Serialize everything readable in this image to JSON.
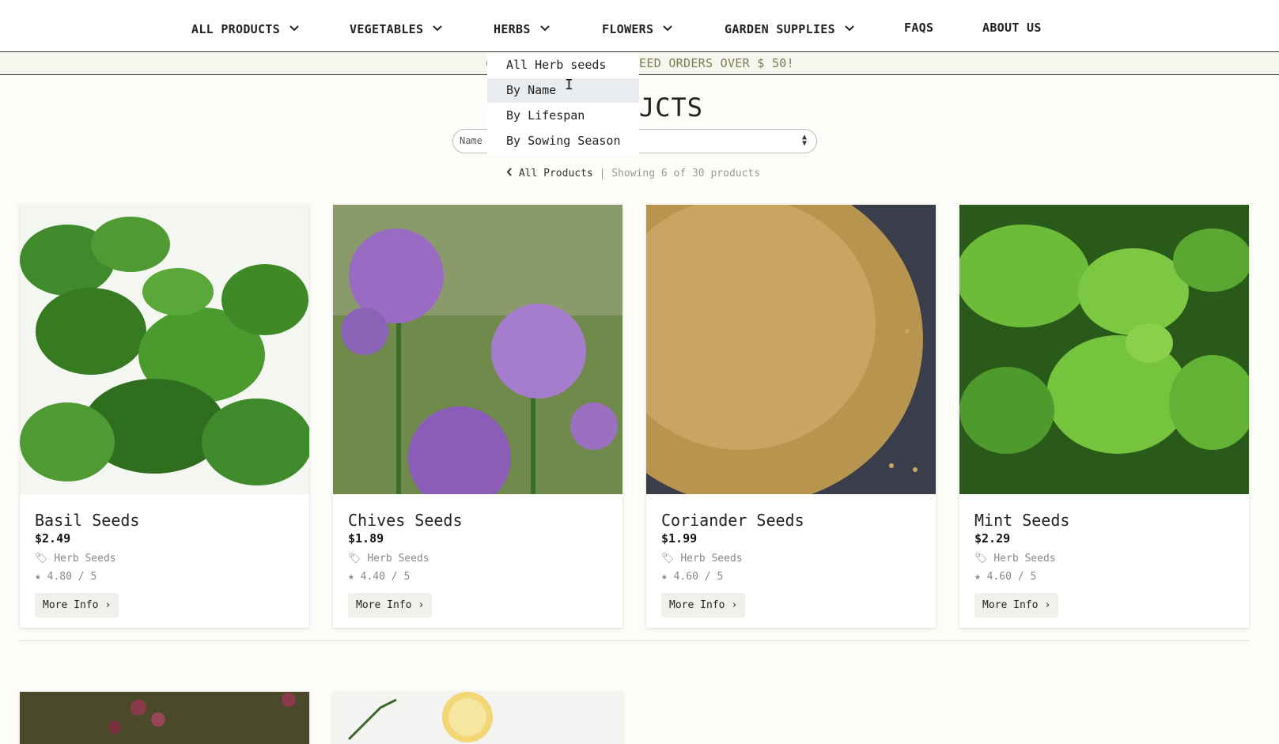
{
  "nav": {
    "items": [
      {
        "label": "ALL PRODUCTS",
        "has_menu": true
      },
      {
        "label": "VEGETABLES",
        "has_menu": true
      },
      {
        "label": "HERBS",
        "has_menu": true
      },
      {
        "label": "FLOWERS",
        "has_menu": true
      },
      {
        "label": "GARDEN SUPPLIES",
        "has_menu": true
      },
      {
        "label": "FAQS",
        "has_menu": false
      },
      {
        "label": "ABOUT US",
        "has_menu": false
      }
    ]
  },
  "banner": {
    "visible_start": "(",
    "visible_end": "EED ORDERS OVER $ 50!"
  },
  "dropdown": {
    "items": [
      {
        "label": "All Herb seeds"
      },
      {
        "label": "By Name"
      },
      {
        "label": "By Lifespan"
      },
      {
        "label": "By Sowing Season"
      }
    ],
    "active": "By Name"
  },
  "page": {
    "title_visible": "JCTS",
    "sort_label": "Name",
    "back_link": "All Products",
    "separator": "|",
    "showing": "Showing 6 of 30 products"
  },
  "products": [
    {
      "name": "Basil Seeds",
      "price": "$2.49",
      "category": "Herb Seeds",
      "rating": "4.80",
      "rating_max": "/ 5",
      "button": "More Info"
    },
    {
      "name": "Chives Seeds",
      "price": "$1.89",
      "category": "Herb Seeds",
      "rating": "4.40",
      "rating_max": "/ 5",
      "button": "More Info"
    },
    {
      "name": "Coriander Seeds",
      "price": "$1.99",
      "category": "Herb Seeds",
      "rating": "4.60",
      "rating_max": "/ 5",
      "button": "More Info"
    },
    {
      "name": "Mint Seeds",
      "price": "$2.29",
      "category": "Herb Seeds",
      "rating": "4.60",
      "rating_max": "/ 5",
      "button": "More Info"
    }
  ],
  "icons": {
    "chevron": "chevron-down-icon",
    "tag": "tag-icon",
    "star": "star-icon",
    "chevron_right": "chevron-right-icon",
    "chevron_left": "chevron-left-icon"
  },
  "colors": {
    "background": "#fdfcf8",
    "banner_text": "#7a7d53",
    "dropdown_active": "#e9ecef"
  }
}
